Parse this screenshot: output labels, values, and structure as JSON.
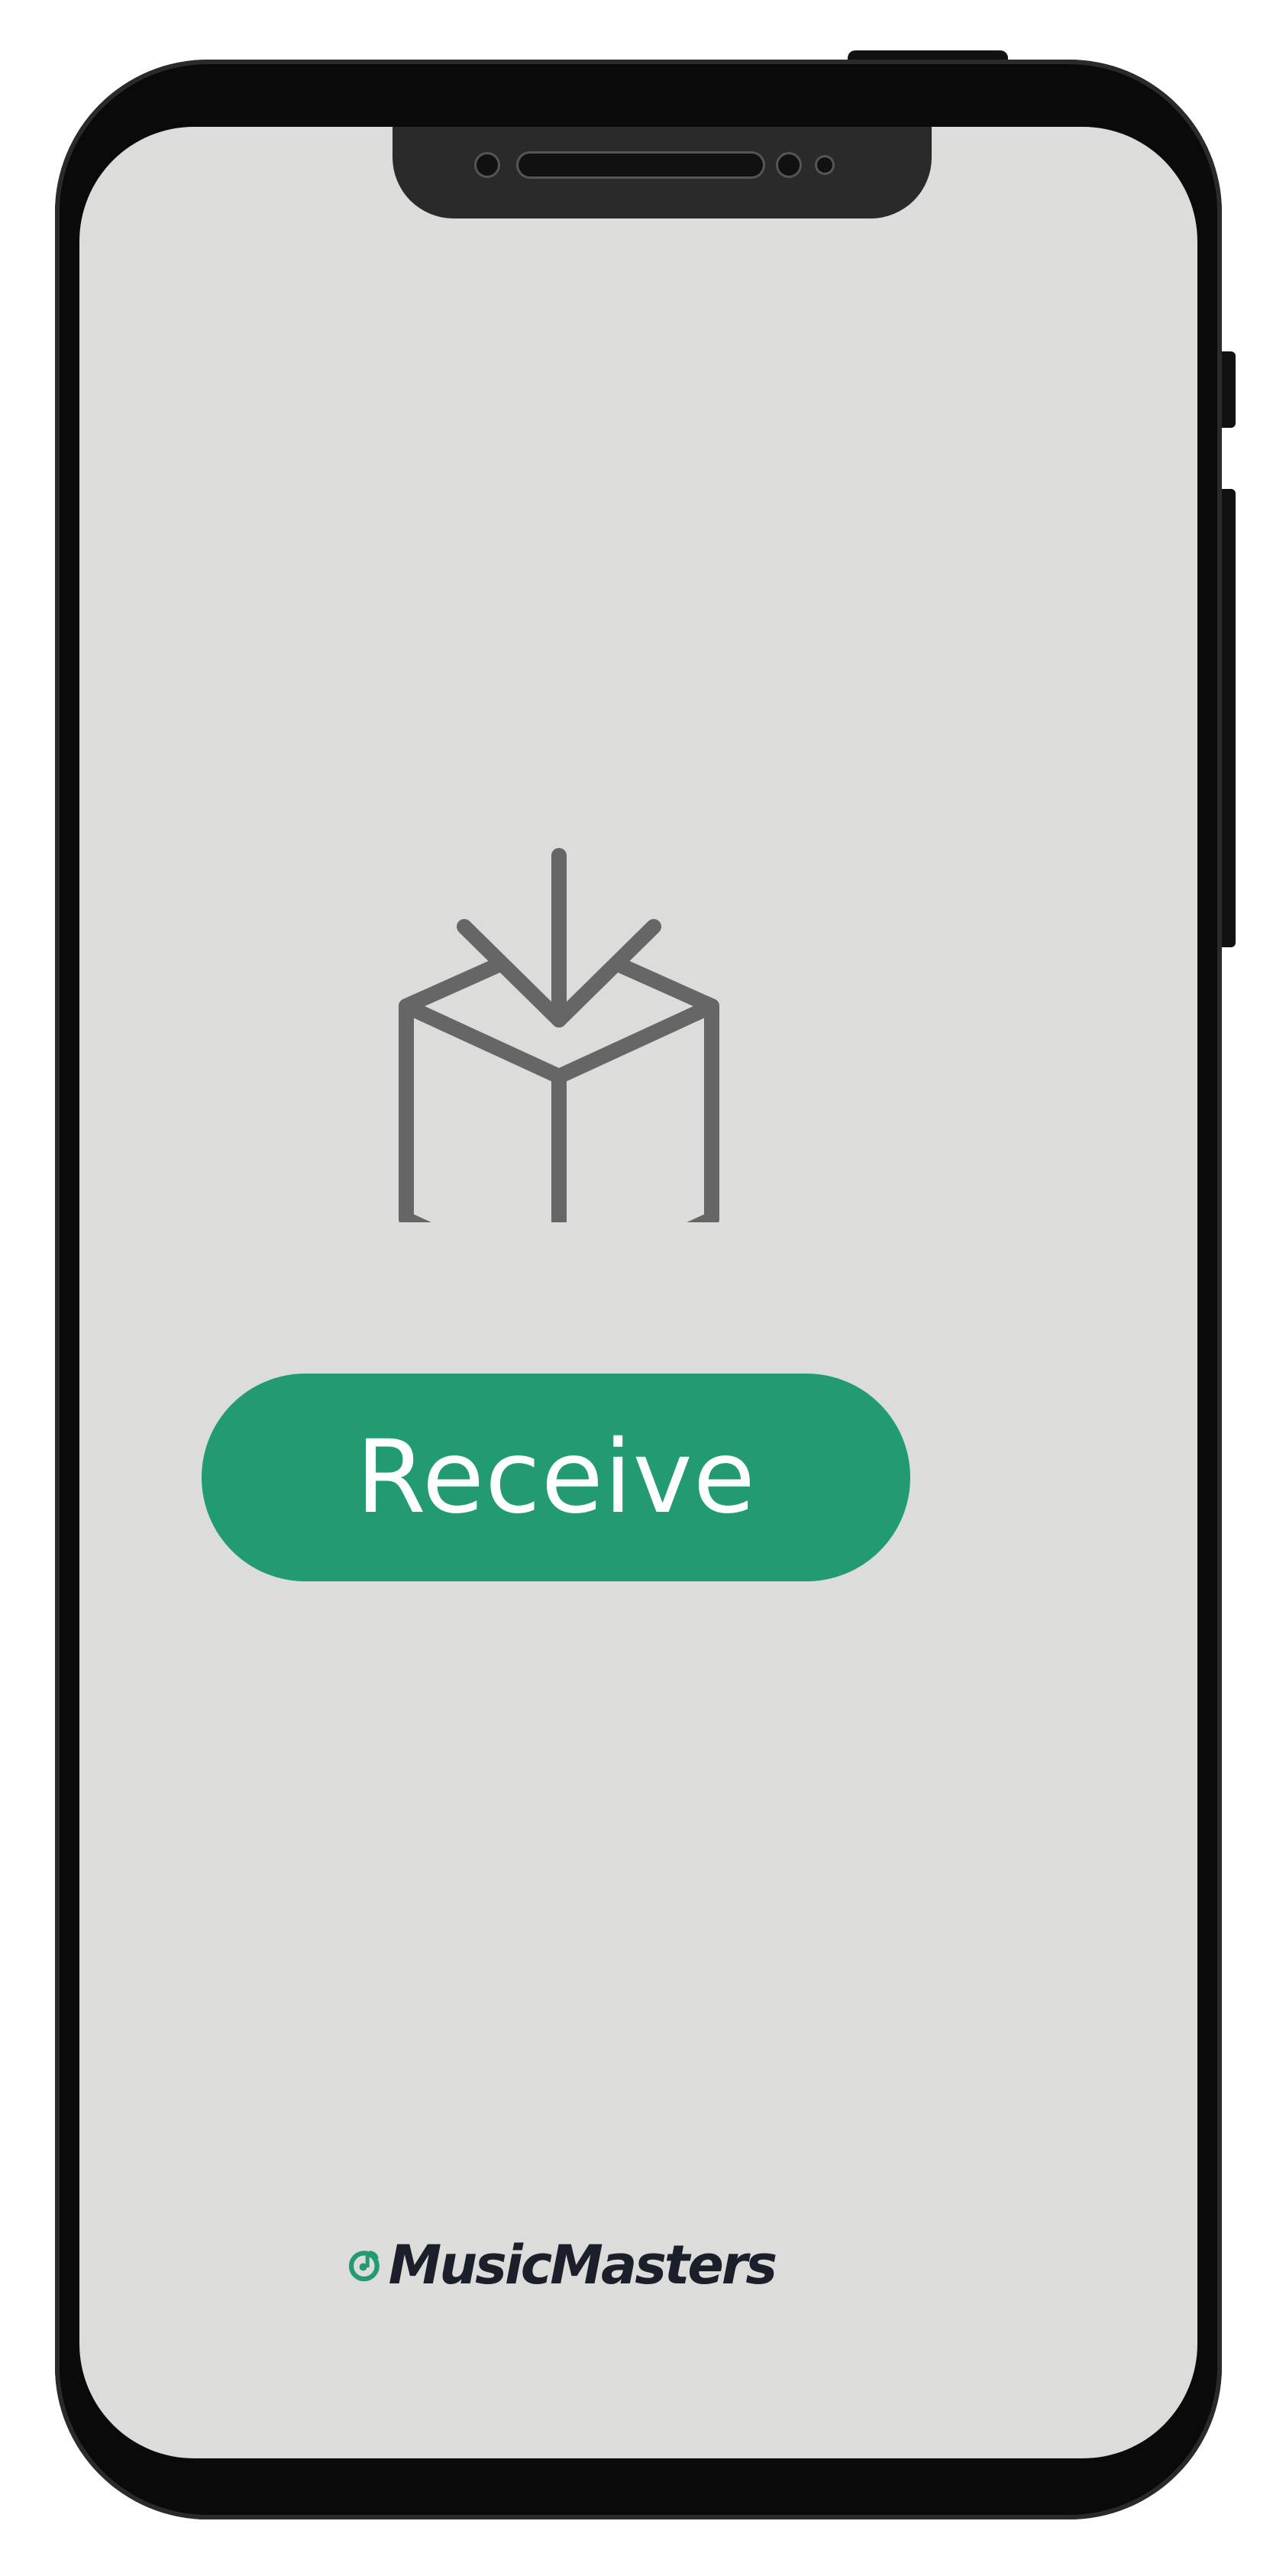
{
  "device": {
    "screen_color": "#dcdcdb",
    "frame_color": "#0a0a0a"
  },
  "main": {
    "icon": "package-receive-icon",
    "icon_color": "#666666",
    "receive_button": {
      "label": "Receive",
      "color": "#229b73"
    }
  },
  "footer": {
    "logo_icon": "musicmasters-logo-icon",
    "logo_color": "#229b73",
    "brand_name": "MusicMasters"
  }
}
